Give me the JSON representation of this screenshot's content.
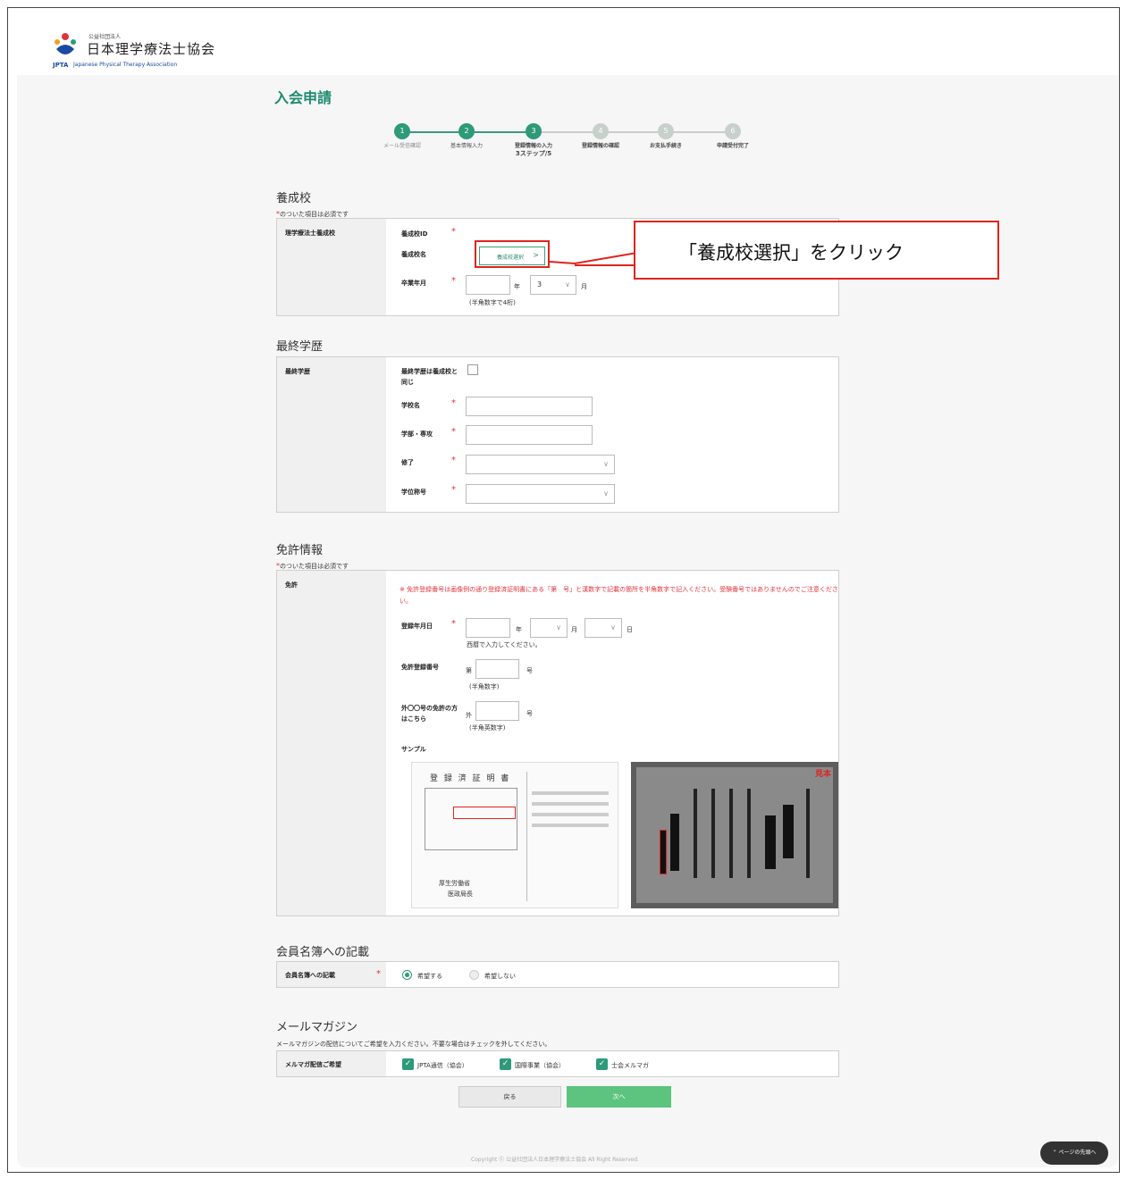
{
  "header": {
    "org_small": "公益社団法人",
    "org_name": "日本理学療法士協会",
    "abbr": "JPTA",
    "org_en": "Japanese Physical Therapy Association"
  },
  "page_title": "入会申請",
  "steps": [
    {
      "num": "1",
      "label": "メール受信確認",
      "state": "done"
    },
    {
      "num": "2",
      "label": "基本情報入力",
      "state": "done"
    },
    {
      "num": "3",
      "label": "登録情報の入力",
      "sub": "3ステップ/5",
      "state": "current"
    },
    {
      "num": "4",
      "label": "登録情報の確認",
      "state": "todo"
    },
    {
      "num": "5",
      "label": "お支払手続き",
      "state": "todo"
    },
    {
      "num": "6",
      "label": "申請受付完了",
      "state": "todo"
    }
  ],
  "required_note": "のついた項目は必須です",
  "required_star": "*",
  "school": {
    "section_title": "養成校",
    "row_label": "理学療法士養成校",
    "id_label": "養成校ID",
    "name_label": "養成校名",
    "select_button": "養成校選択",
    "grad_label": "卒業年月",
    "year_unit": "年",
    "month_value": "3",
    "month_unit": "月",
    "hint": "(半角数字で4桁)"
  },
  "callout_text": "「養成校選択」をクリック",
  "education": {
    "section_title": "最終学歴",
    "row_label": "最終学歴",
    "same_label_1": "最終学歴は養成校と",
    "same_label_2": "同じ",
    "school_name": "学校名",
    "faculty": "学部・専攻",
    "completion": "修了",
    "degree": "学位称号"
  },
  "license": {
    "section_title": "免許情報",
    "row_label": "免許",
    "notice": "※ 免許登録番号は画像例の通り登録済証明書にある「第　号」と漢数字で記載の箇所を半角数字で記入ください。受験番号ではありませんのでご注意ください。",
    "reg_date_label": "登録年月日",
    "year_unit": "年",
    "month_unit": "月",
    "day_unit": "日",
    "date_hint": "西暦で入力してください。",
    "reg_no_label": "免許登録番号",
    "dai": "第",
    "go": "号",
    "reg_no_hint": "(半角数字)",
    "foreign_label_1": "外〇〇号の免許の方",
    "foreign_label_2": "はこちら",
    "gai": "外",
    "foreign_hint": "(半角英数字)",
    "sample_label": "サンプル",
    "sample1_title": "登 録 済 証 明 書",
    "sample1_issuer_1": "厚生労働省",
    "sample1_issuer_2": "医政局長",
    "sample2_mark": "見本"
  },
  "directory": {
    "section_title": "会員名簿への記載",
    "row_label": "会員名簿への記載",
    "opt_yes": "希望する",
    "opt_no": "希望しない"
  },
  "mail": {
    "section_title": "メールマガジン",
    "desc": "メールマガジンの配信についてご希望を入力ください。不要な場合はチェックを外してください。",
    "row_label": "メルマガ配信ご希望",
    "opt1": "JPTA通信（協会）",
    "opt2": "国際事業（協会）",
    "opt3": "士会メルマガ"
  },
  "buttons": {
    "back": "戻る",
    "next": "次へ"
  },
  "footer": {
    "copyright": "Copyright Ⓒ 公益社団法人日本理学療法士協会 All Right Reserved.",
    "page_top": "ページの先頭へ"
  },
  "colors": {
    "accent": "#2e9a78",
    "required": "#e0333a",
    "highlight": "#e0231e",
    "next_button": "#5cc47e"
  }
}
